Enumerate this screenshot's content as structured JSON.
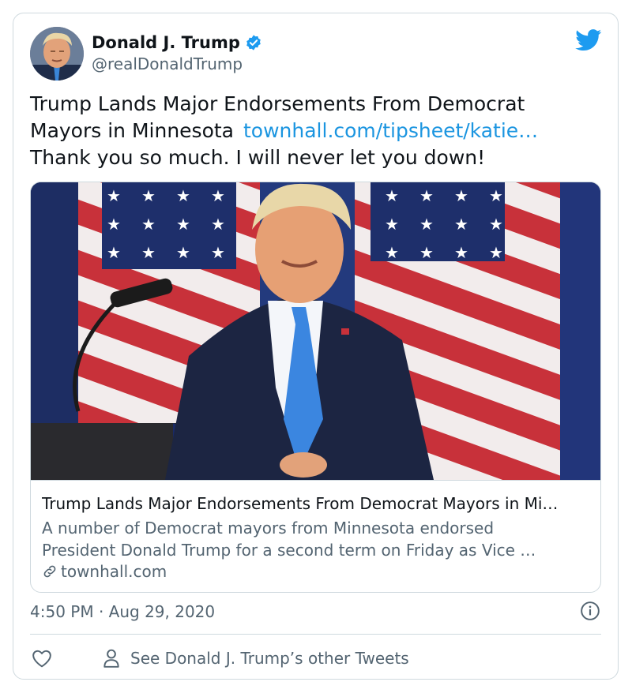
{
  "author": {
    "name": "Donald J. Trump",
    "handle": "@realDonaldTrump",
    "verified_icon": "verified-badge-icon",
    "avatar": "avatar-photo"
  },
  "platform_icon": "twitter-bird-icon",
  "tweet": {
    "text_line1": "Trump Lands Major Endorsements From Democrat",
    "text_line2": "Mayors in Minnesota",
    "link": "townhall.com/tipsheet/katie…",
    "text_line3": "Thank you so much. I will never let you down!"
  },
  "link_card": {
    "title": "Trump Lands Major Endorsements From Democrat Mayors in Mi…",
    "description_line1": "A number of Democrat mayors from Minnesota endorsed",
    "description_line2": "President Donald Trump for a second term on Friday as Vice …",
    "domain": "townhall.com",
    "domain_icon": "link-icon"
  },
  "timestamp": "4:50 PM · Aug 29, 2020",
  "info_icon": "info-icon",
  "actions": {
    "like_icon": "heart-icon",
    "person_icon": "person-icon",
    "other_tweets_label": "See Donald J. Trump’s other Tweets"
  },
  "colors": {
    "link": "#1b95e0",
    "secondary_text": "#536471",
    "border": "#cfd9de",
    "twitter_blue": "#1d9bf0"
  }
}
